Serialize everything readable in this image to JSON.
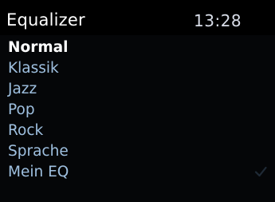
{
  "header": {
    "title": "Equalizer",
    "time": "13:28"
  },
  "menu": {
    "selected_index": 0,
    "items": [
      {
        "label": "Normal",
        "selected": true,
        "checked": false
      },
      {
        "label": "Klassik",
        "selected": false,
        "checked": false
      },
      {
        "label": "Jazz",
        "selected": false,
        "checked": false
      },
      {
        "label": "Pop",
        "selected": false,
        "checked": false
      },
      {
        "label": "Rock",
        "selected": false,
        "checked": false
      },
      {
        "label": "Sprache",
        "selected": false,
        "checked": false
      },
      {
        "label": "Mein EQ",
        "selected": false,
        "checked": true,
        "icon": "checkmark-icon"
      }
    ]
  },
  "colors": {
    "background": "#050608",
    "header_background": "#000000",
    "selected_text": "#ffffff",
    "item_text": "#9fc0e0",
    "check_color": "#1f2a36"
  }
}
